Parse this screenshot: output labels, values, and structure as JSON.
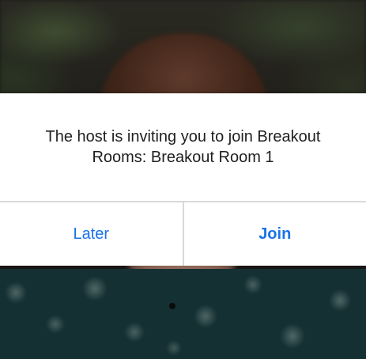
{
  "dialog": {
    "message": "The host is inviting you to join Breakout Rooms: Breakout Room 1",
    "later_label": "Later",
    "join_label": "Join"
  },
  "colors": {
    "action_blue": "#1a73e8",
    "dialog_background": "#ffffff",
    "divider": "#d9d9d9"
  }
}
